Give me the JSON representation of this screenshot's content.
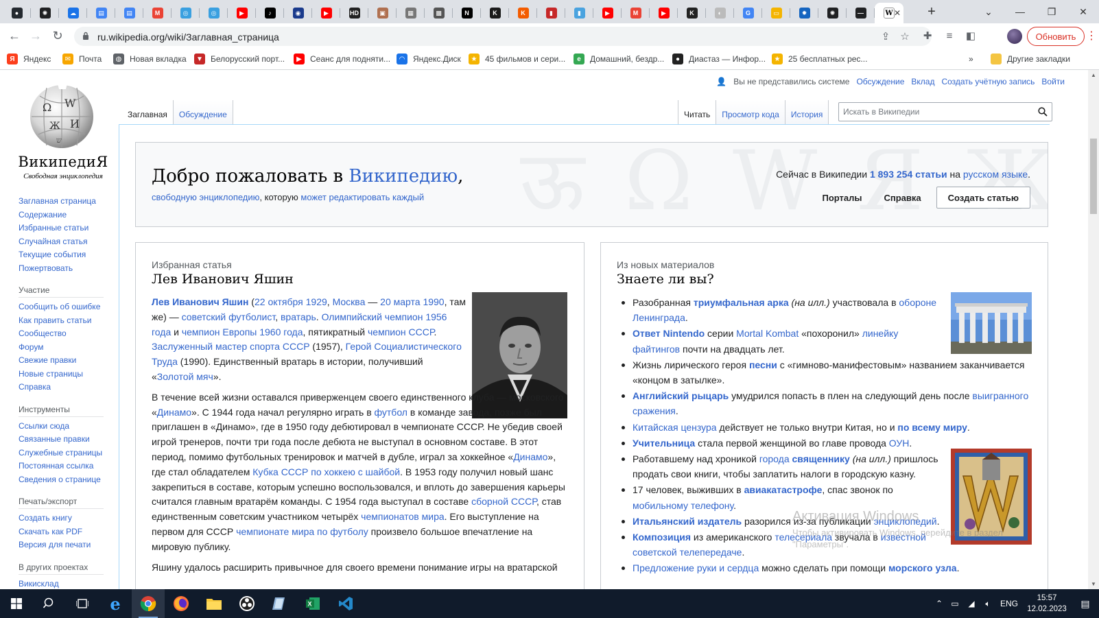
{
  "browser": {
    "tabs": [
      {
        "icon": "github-icon",
        "color": "#24292f",
        "glyph": "●"
      },
      {
        "icon": "openai-icon",
        "color": "#202123",
        "glyph": "✺"
      },
      {
        "icon": "cloud-icon",
        "color": "#1a73e8",
        "glyph": "☁"
      },
      {
        "icon": "docs-icon",
        "color": "#4285f4",
        "glyph": "▤"
      },
      {
        "icon": "docs-icon",
        "color": "#4285f4",
        "glyph": "▤"
      },
      {
        "icon": "gmail-icon",
        "color": "#ea4335",
        "glyph": "M"
      },
      {
        "icon": "swirl-icon",
        "color": "#3aa0e0",
        "glyph": "◎"
      },
      {
        "icon": "swirl-icon",
        "color": "#3aa0e0",
        "glyph": "◎"
      },
      {
        "icon": "youtube-icon",
        "color": "#ff0000",
        "glyph": "▶"
      },
      {
        "icon": "tiktok-icon",
        "color": "#000000",
        "glyph": "♪"
      },
      {
        "icon": "eye-icon",
        "color": "#1a3a8c",
        "glyph": "◉"
      },
      {
        "icon": "youtube-icon",
        "color": "#ff0000",
        "glyph": "▶"
      },
      {
        "icon": "hd-icon",
        "color": "#222222",
        "glyph": "HD"
      },
      {
        "icon": "photo-icon",
        "color": "#b07050",
        "glyph": "▣"
      },
      {
        "icon": "image-icon",
        "color": "#777777",
        "glyph": "▦"
      },
      {
        "icon": "texture-icon",
        "color": "#555555",
        "glyph": "▩"
      },
      {
        "icon": "notion-icon",
        "color": "#000000",
        "glyph": "N"
      },
      {
        "icon": "kinopoisk-icon",
        "color": "#1b1b1b",
        "glyph": "K"
      },
      {
        "icon": "k-icon",
        "color": "#f35c00",
        "glyph": "K"
      },
      {
        "icon": "book-icon",
        "color": "#c62828",
        "glyph": "▮"
      },
      {
        "icon": "book-icon",
        "color": "#4aa3df",
        "glyph": "▮"
      },
      {
        "icon": "youtube-icon",
        "color": "#ff0000",
        "glyph": "▶"
      },
      {
        "icon": "gmail-icon",
        "color": "#ea4335",
        "glyph": "M"
      },
      {
        "icon": "youtube-icon",
        "color": "#ff0000",
        "glyph": "▶"
      },
      {
        "icon": "k-icon",
        "color": "#222222",
        "glyph": "K"
      },
      {
        "icon": "globe-icon",
        "color": "#bbbbbb",
        "glyph": "◐"
      },
      {
        "icon": "google-icon",
        "color": "#4285f4",
        "glyph": "G"
      },
      {
        "icon": "slides-icon",
        "color": "#f4b400",
        "glyph": "▭"
      },
      {
        "icon": "gear-icon",
        "color": "#1565c0",
        "glyph": "✹"
      },
      {
        "icon": "openai-icon",
        "color": "#202123",
        "glyph": "✺"
      },
      {
        "icon": "dash-icon",
        "color": "#202123",
        "glyph": "—"
      }
    ],
    "active_tab": {
      "icon": "wikipedia-icon",
      "glyph": "W"
    },
    "url": "ru.wikipedia.org/wiki/Заглавная_страница",
    "update_label": "Обновить",
    "bookmarks": [
      {
        "label": "Яндекс",
        "icon": "yandex-icon",
        "color": "#fc3f1d",
        "glyph": "Я"
      },
      {
        "label": "Почта",
        "icon": "mail-icon",
        "color": "#f7a600",
        "glyph": "✉"
      },
      {
        "label": "Новая вкладка",
        "icon": "newtab-icon",
        "color": "#5f6368",
        "glyph": "◍"
      },
      {
        "label": "Белорусский порт...",
        "icon": "shield-icon",
        "color": "#c62828",
        "glyph": "▼"
      },
      {
        "label": "Сеанс для подняти...",
        "icon": "youtube-icon",
        "color": "#ff0000",
        "glyph": "▶"
      },
      {
        "label": "Яндекс.Диск",
        "icon": "disk-icon",
        "color": "#1a73e8",
        "glyph": "◠"
      },
      {
        "label": "45 фильмов и сери...",
        "icon": "star-icon",
        "color": "#f4b400",
        "glyph": "★"
      },
      {
        "label": "Домашний, бездр...",
        "icon": "e-icon",
        "color": "#34a853",
        "glyph": "e"
      },
      {
        "label": "Диастаз — Инфор...",
        "icon": "circle-icon",
        "color": "#222222",
        "glyph": "●"
      },
      {
        "label": "25 бесплатных рес...",
        "icon": "star-icon",
        "color": "#f4b400",
        "glyph": "★"
      }
    ],
    "other_bookmarks": "Другие закладки"
  },
  "wiki": {
    "logo_wordmark": "ВикипедиЯ",
    "logo_tagline": "Свободная энциклопедия",
    "personal": {
      "not_logged": "Вы не представились системе",
      "talk": "Обсуждение",
      "contrib": "Вклад",
      "create_account": "Создать учётную запись",
      "login": "Войти"
    },
    "tabs_left": [
      "Заглавная",
      "Обсуждение"
    ],
    "tabs_right": [
      "Читать",
      "Просмотр кода",
      "История"
    ],
    "search_placeholder": "Искать в Википедии",
    "sidebar": {
      "main": [
        "Заглавная страница",
        "Содержание",
        "Избранные статьи",
        "Случайная статья",
        "Текущие события",
        "Пожертвовать"
      ],
      "participation_head": "Участие",
      "participation": [
        "Сообщить об ошибке",
        "Как править статьи",
        "Сообщество",
        "Форум",
        "Свежие правки",
        "Новые страницы",
        "Справка"
      ],
      "tools_head": "Инструменты",
      "tools": [
        "Ссылки сюда",
        "Связанные правки",
        "Служебные страницы",
        "Постоянная ссылка",
        "Сведения о странице"
      ],
      "print_head": "Печать/экспорт",
      "print": [
        "Создать книгу",
        "Скачать как PDF",
        "Версия для печати"
      ],
      "projects_head": "В других проектах",
      "projects": [
        "Викисклад"
      ]
    },
    "welcome": {
      "title_plain": "Добро пожаловать в ",
      "title_link": "Википедию",
      "title_end": ",",
      "sub_link1": "свободную энциклопедию",
      "sub_text": ", которую ",
      "sub_link2": "может редактировать каждый",
      "stats_prefix": "Сейчас в Википедии ",
      "stats_count": "1 893 254 статьи",
      "stats_mid": " на ",
      "stats_lang": "русском языке",
      "stats_end": ".",
      "portals": "Порталы",
      "help": "Справка",
      "create": "Создать статью",
      "bg_letters": "ऊ Ω W Я Ж ש"
    },
    "featured": {
      "label": "Избранная статья",
      "title": "Лев Иванович Яшин",
      "p1": [
        {
          "t": "Лев Иванович Яшин",
          "l": true,
          "b": true
        },
        {
          "t": " (",
          "l": false
        },
        {
          "t": "22 октября",
          "l": true
        },
        {
          "t": " ",
          "l": false
        },
        {
          "t": "1929",
          "l": true
        },
        {
          "t": ", ",
          "l": false
        },
        {
          "t": "Москва",
          "l": true
        },
        {
          "t": " — ",
          "l": false
        },
        {
          "t": "20 марта",
          "l": true
        },
        {
          "t": " ",
          "l": false
        },
        {
          "t": "1990",
          "l": true
        },
        {
          "t": ", там же) — ",
          "l": false
        },
        {
          "t": "советский",
          "l": true
        },
        {
          "t": " ",
          "l": false
        },
        {
          "t": "футболист",
          "l": true
        },
        {
          "t": ", ",
          "l": false
        },
        {
          "t": "вратарь",
          "l": true
        },
        {
          "t": ". ",
          "l": false
        },
        {
          "t": "Олимпийский чемпион 1956 года",
          "l": true
        },
        {
          "t": " и ",
          "l": false
        },
        {
          "t": "чемпион Европы 1960 года",
          "l": true
        },
        {
          "t": ", пятикратный ",
          "l": false
        },
        {
          "t": "чемпион СССР",
          "l": true
        },
        {
          "t": ". ",
          "l": false
        },
        {
          "t": "Заслуженный мастер спорта СССР",
          "l": true
        },
        {
          "t": " (1957), ",
          "l": false
        },
        {
          "t": "Герой Социалистического Труда",
          "l": true
        },
        {
          "t": " (1990). Единственный вратарь в истории, получивший «",
          "l": false
        },
        {
          "t": "Золотой мяч",
          "l": true
        },
        {
          "t": "».",
          "l": false
        }
      ],
      "p2": [
        {
          "t": "В течение всей жизни оставался приверженцем своего единственного клуба — московского «",
          "l": false
        },
        {
          "t": "Динамо",
          "l": true
        },
        {
          "t": "». С 1944 года начал регулярно играть в ",
          "l": false
        },
        {
          "t": "футбол",
          "l": true
        },
        {
          "t": " в команде завода, позже был приглашен в «Динамо», где в 1950 году дебютировал в чемпионате СССР. Не убедив своей игрой тренеров, почти три года после дебюта не выступал в основном составе. В этот период, помимо футбольных тренировок и матчей в дубле, играл за хоккейное «",
          "l": false
        },
        {
          "t": "Динамо",
          "l": true
        },
        {
          "t": "», где стал обладателем ",
          "l": false
        },
        {
          "t": "Кубка СССР по хоккею с шайбой",
          "l": true
        },
        {
          "t": ". В 1953 году получил новый шанс закрепиться в составе, которым успешно воспользовался, и вплоть до завершения карьеры считался главным вратарём команды. С 1954 года выступал в составе ",
          "l": false
        },
        {
          "t": "сборной СССР",
          "l": true
        },
        {
          "t": ", став единственным советским участником четырёх ",
          "l": false
        },
        {
          "t": "чемпионатов мира",
          "l": true
        },
        {
          "t": ". Его выступление на первом для СССР ",
          "l": false
        },
        {
          "t": "чемпионате мира по футболу",
          "l": true
        },
        {
          "t": " произвело большое впечатление на мировую публику.",
          "l": false
        }
      ],
      "p3": [
        {
          "t": "Яшину удалось расширить привычное для своего времени понимание игры на вратарской",
          "l": false
        }
      ]
    },
    "dyk": {
      "label": "Из новых материалов",
      "title": "Знаете ли вы?",
      "items": [
        [
          {
            "t": "Разобранная ",
            "l": false
          },
          {
            "t": "триумфальная арка",
            "l": true,
            "b": true
          },
          {
            "t": " (на илл.)",
            "l": false,
            "i": true
          },
          {
            "t": " участвовала в ",
            "l": false
          },
          {
            "t": "обороне Ленинграда",
            "l": true
          },
          {
            "t": ".",
            "l": false
          }
        ],
        [
          {
            "t": "Ответ Nintendo",
            "l": true,
            "b": true
          },
          {
            "t": " серии ",
            "l": false
          },
          {
            "t": "Mortal Kombat",
            "l": true
          },
          {
            "t": " «похоронил» ",
            "l": false
          },
          {
            "t": "линейку файтингов",
            "l": true
          },
          {
            "t": " почти на двадцать лет.",
            "l": false
          }
        ],
        [
          {
            "t": "Жизнь лирического героя ",
            "l": false
          },
          {
            "t": "песни",
            "l": true,
            "b": true
          },
          {
            "t": " с «гимново-манифестовым» названием заканчивается «концом в затылке».",
            "l": false
          }
        ],
        [
          {
            "t": "Английский рыцарь",
            "l": true,
            "b": true
          },
          {
            "t": " умудрился попасть в плен на следующий день после ",
            "l": false
          },
          {
            "t": "выигранного сражения",
            "l": true
          },
          {
            "t": ".",
            "l": false
          }
        ],
        [
          {
            "t": "Китайская цензура",
            "l": true
          },
          {
            "t": " действует не только внутри Китая, но и ",
            "l": false
          },
          {
            "t": "по всему миру",
            "l": true,
            "b": true
          },
          {
            "t": ".",
            "l": false
          }
        ],
        [
          {
            "t": "Учительница",
            "l": true,
            "b": true
          },
          {
            "t": " стала первой женщиной во главе провода ",
            "l": false
          },
          {
            "t": "ОУН",
            "l": true
          },
          {
            "t": ".",
            "l": false
          }
        ],
        [
          {
            "t": "Работавшему над хроникой ",
            "l": false
          },
          {
            "t": "города",
            "l": true
          },
          {
            "t": " ",
            "l": false
          },
          {
            "t": "священнику",
            "l": true,
            "b": true
          },
          {
            "t": " (на илл.)",
            "l": false,
            "i": true
          },
          {
            "t": " пришлось продать свои книги, чтобы заплатить налоги в городскую казну.",
            "l": false
          }
        ],
        [
          {
            "t": "17 человек, выживших в ",
            "l": false
          },
          {
            "t": "авиакатастрофе",
            "l": true,
            "b": true
          },
          {
            "t": ", спас звонок по ",
            "l": false
          },
          {
            "t": "мобильному телефону",
            "l": true
          },
          {
            "t": ".",
            "l": false
          }
        ],
        [
          {
            "t": "Итальянский издатель",
            "l": true,
            "b": true
          },
          {
            "t": " разорился из-за публикации ",
            "l": false
          },
          {
            "t": "энциклопедий",
            "l": true
          },
          {
            "t": ".",
            "l": false
          }
        ],
        [
          {
            "t": "Композиция",
            "l": true,
            "b": true
          },
          {
            "t": " из американского ",
            "l": false
          },
          {
            "t": "телесериала",
            "l": true
          },
          {
            "t": " звучала в ",
            "l": false
          },
          {
            "t": "известной советской телепередаче",
            "l": true
          },
          {
            "t": ".",
            "l": false
          }
        ],
        [
          {
            "t": "Предложение руки и сердца",
            "l": true
          },
          {
            "t": " можно сделать при помощи ",
            "l": false
          },
          {
            "t": "морского узла",
            "l": true,
            "b": true
          },
          {
            "t": ".",
            "l": false
          }
        ]
      ]
    }
  },
  "watermark": {
    "line1": "Активация Windows",
    "line2": "Чтобы активировать Windows, перейдите в раздел",
    "line3": "\"Параметры\"."
  },
  "taskbar": {
    "lang": "ENG",
    "time": "15:57",
    "date": "12.02.2023"
  }
}
